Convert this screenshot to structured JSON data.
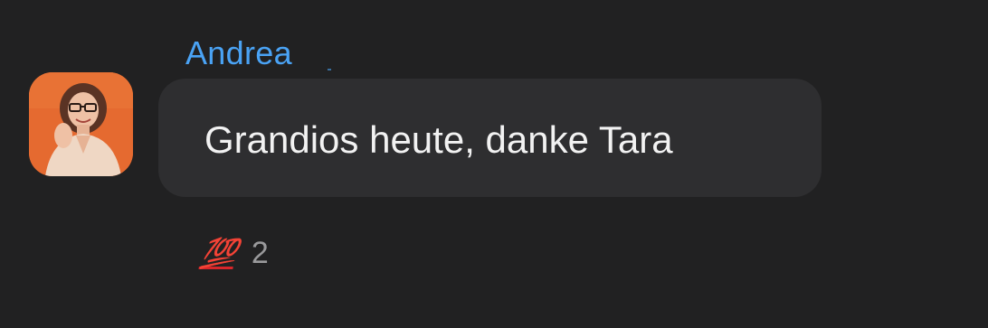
{
  "message": {
    "sender": "Andrea",
    "text": "Grandios heute, danke Tara",
    "avatar_icon": "profile-photo-icon"
  },
  "reactions": [
    {
      "emoji": "💯",
      "emoji_icon": "hundred-points-icon",
      "count": "2"
    }
  ],
  "colors": {
    "background": "#212122",
    "bubble": "#2e2e30",
    "sender_name": "#4aa3f5",
    "avatar_background": "#e8692f",
    "reaction_emoji": "#d8262a"
  }
}
